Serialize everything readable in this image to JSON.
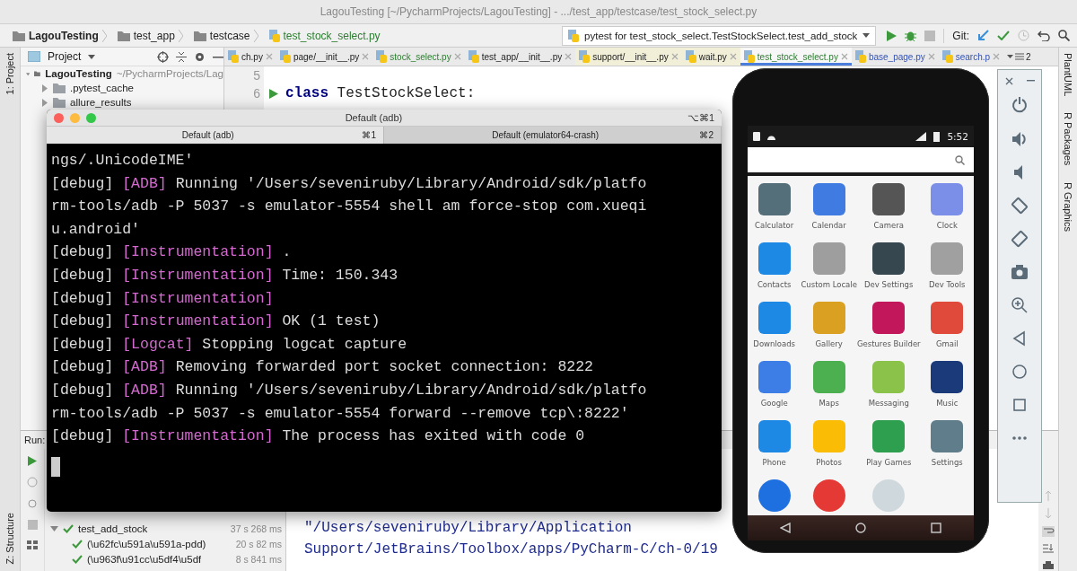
{
  "ide": {
    "title": "LagouTesting [~/PycharmProjects/LagouTesting] - .../test_app/testcase/test_stock_select.py",
    "breadcrumbs": [
      "LagouTesting",
      "test_app",
      "testcase",
      "test_stock_select.py"
    ],
    "run_config": "pytest for test_stock_select.TestStockSelect.test_add_stock",
    "git_label": "Git:",
    "left_stripe": [
      "1: Project",
      "Z: Structure"
    ],
    "right_stripe": [
      "PlantUML",
      "R Packages",
      "R Graphics"
    ],
    "project_panel": {
      "title": "Project",
      "tree": [
        {
          "name": "LagouTesting",
          "path": "~/PycharmProjects/Lag",
          "expanded": true,
          "children": [
            {
              "name": ".pytest_cache",
              "expanded": false
            },
            {
              "name": "allure_results",
              "expanded": false
            }
          ]
        }
      ]
    },
    "editor_tabs": [
      {
        "label": "ch.py",
        "added": false,
        "modified": false,
        "selected": false
      },
      {
        "label": "page/__init__.py",
        "added": false,
        "modified": false,
        "selected": false
      },
      {
        "label": "stock_select.py",
        "added": true,
        "modified": false,
        "selected": false
      },
      {
        "label": "test_app/__init__.py",
        "added": false,
        "modified": false,
        "selected": false
      },
      {
        "label": "support/__init__.py",
        "added": false,
        "modified": false,
        "selected": false
      },
      {
        "label": "wait.py",
        "added": false,
        "modified": false,
        "selected": false
      },
      {
        "label": "test_stock_select.py",
        "added": true,
        "modified": false,
        "selected": true
      },
      {
        "label": "base_page.py",
        "added": false,
        "modified": true,
        "selected": false
      },
      {
        "label": "search.p",
        "added": false,
        "modified": true,
        "selected": false
      }
    ],
    "tab_overflow": "2",
    "editor_lines": [
      {
        "number": "5"
      },
      {
        "number": "6",
        "code": "**class** TestStockSelect:"
      }
    ],
    "run_panel": {
      "label": "Run:",
      "tests": [
        {
          "name": "test_add_stock",
          "time": "37 s 268 ms",
          "passed": true,
          "expanded": true,
          "children": [
            {
              "name": "(\\u62fc\\u591a\\u591a-pdd)",
              "time": "20 s 82 ms",
              "passed": true
            },
            {
              "name": "(\\u963f\\u91cc\\u5df4\\u5df",
              "time": "8 s 841 ms",
              "passed": true
            }
          ]
        }
      ],
      "output": [
        "\"/Users/seveniruby/Library/Application",
        "Support/JetBrains/Toolbox/apps/PyCharm-C/ch-0/19"
      ]
    }
  },
  "terminal": {
    "title": "Default (adb)",
    "shortcut": "⌥⌘1",
    "tabs": [
      {
        "label": "Default (adb)",
        "shortcut": "⌘1",
        "selected": true
      },
      {
        "label": "Default (emulator64-crash)",
        "shortcut": "⌘2",
        "selected": false
      }
    ],
    "lines": [
      {
        "text": "ngs/.UnicodeIME'"
      },
      {
        "level": "[debug]",
        "tag": "[ADB]",
        "text": "Running '/Users/seveniruby/Library/Android/sdk/platfo"
      },
      {
        "text": "rm-tools/adb -P 5037 -s emulator-5554 shell am force-stop com.xueqi"
      },
      {
        "text": "u.android'"
      },
      {
        "level": "[debug]",
        "tag": "[Instrumentation]",
        "text": "."
      },
      {
        "level": "[debug]",
        "tag": "[Instrumentation]",
        "text": "Time: 150.343"
      },
      {
        "level": "[debug]",
        "tag": "[Instrumentation]"
      },
      {
        "level": "[debug]",
        "tag": "[Instrumentation]",
        "text": "OK (1 test)"
      },
      {
        "level": "[debug]",
        "tag": "[Logcat]",
        "text": "Stopping logcat capture"
      },
      {
        "level": "[debug]",
        "tag": "[ADB]",
        "text": "Removing forwarded port socket connection: 8222"
      },
      {
        "level": "[debug]",
        "tag": "[ADB]",
        "text": "Running '/Users/seveniruby/Library/Android/sdk/platfo"
      },
      {
        "text": "rm-tools/adb -P 5037 -s emulator-5554 forward --remove tcp\\:8222'"
      },
      {
        "level": "[debug]",
        "tag": "[Instrumentation]",
        "text": "The process has exited with code 0"
      }
    ]
  },
  "phone": {
    "time": "5:52",
    "apps": [
      {
        "label": "Calculator",
        "color": "#546e7a"
      },
      {
        "label": "Calendar",
        "color": "#3f7be0"
      },
      {
        "label": "Camera",
        "color": "#555555"
      },
      {
        "label": "Clock",
        "color": "#7b8ee8"
      },
      {
        "label": "Contacts",
        "color": "#1e88e5"
      },
      {
        "label": "Custom Locale",
        "color": "#9e9e9e"
      },
      {
        "label": "Dev Settings",
        "color": "#37474f"
      },
      {
        "label": "Dev Tools",
        "color": "#a0a0a0"
      },
      {
        "label": "Downloads",
        "color": "#1e88e5"
      },
      {
        "label": "Gallery",
        "color": "#d9a021"
      },
      {
        "label": "Gestures Builder",
        "color": "#c2185b"
      },
      {
        "label": "Gmail",
        "color": "#e04a3a"
      },
      {
        "label": "Google",
        "color": "#3d7de6"
      },
      {
        "label": "Maps",
        "color": "#4caf50"
      },
      {
        "label": "Messaging",
        "color": "#8bc34a"
      },
      {
        "label": "Music",
        "color": "#1a3a7a"
      },
      {
        "label": "Phone",
        "color": "#1e88e5"
      },
      {
        "label": "Photos",
        "color": "#fbbc05"
      },
      {
        "label": "Play Games",
        "color": "#2e9e4f"
      },
      {
        "label": "Settings",
        "color": "#607d8b"
      },
      {
        "color": "#1e6fe0"
      },
      {
        "color": "#e53935"
      },
      {
        "color": "#cfd8dc"
      }
    ]
  }
}
